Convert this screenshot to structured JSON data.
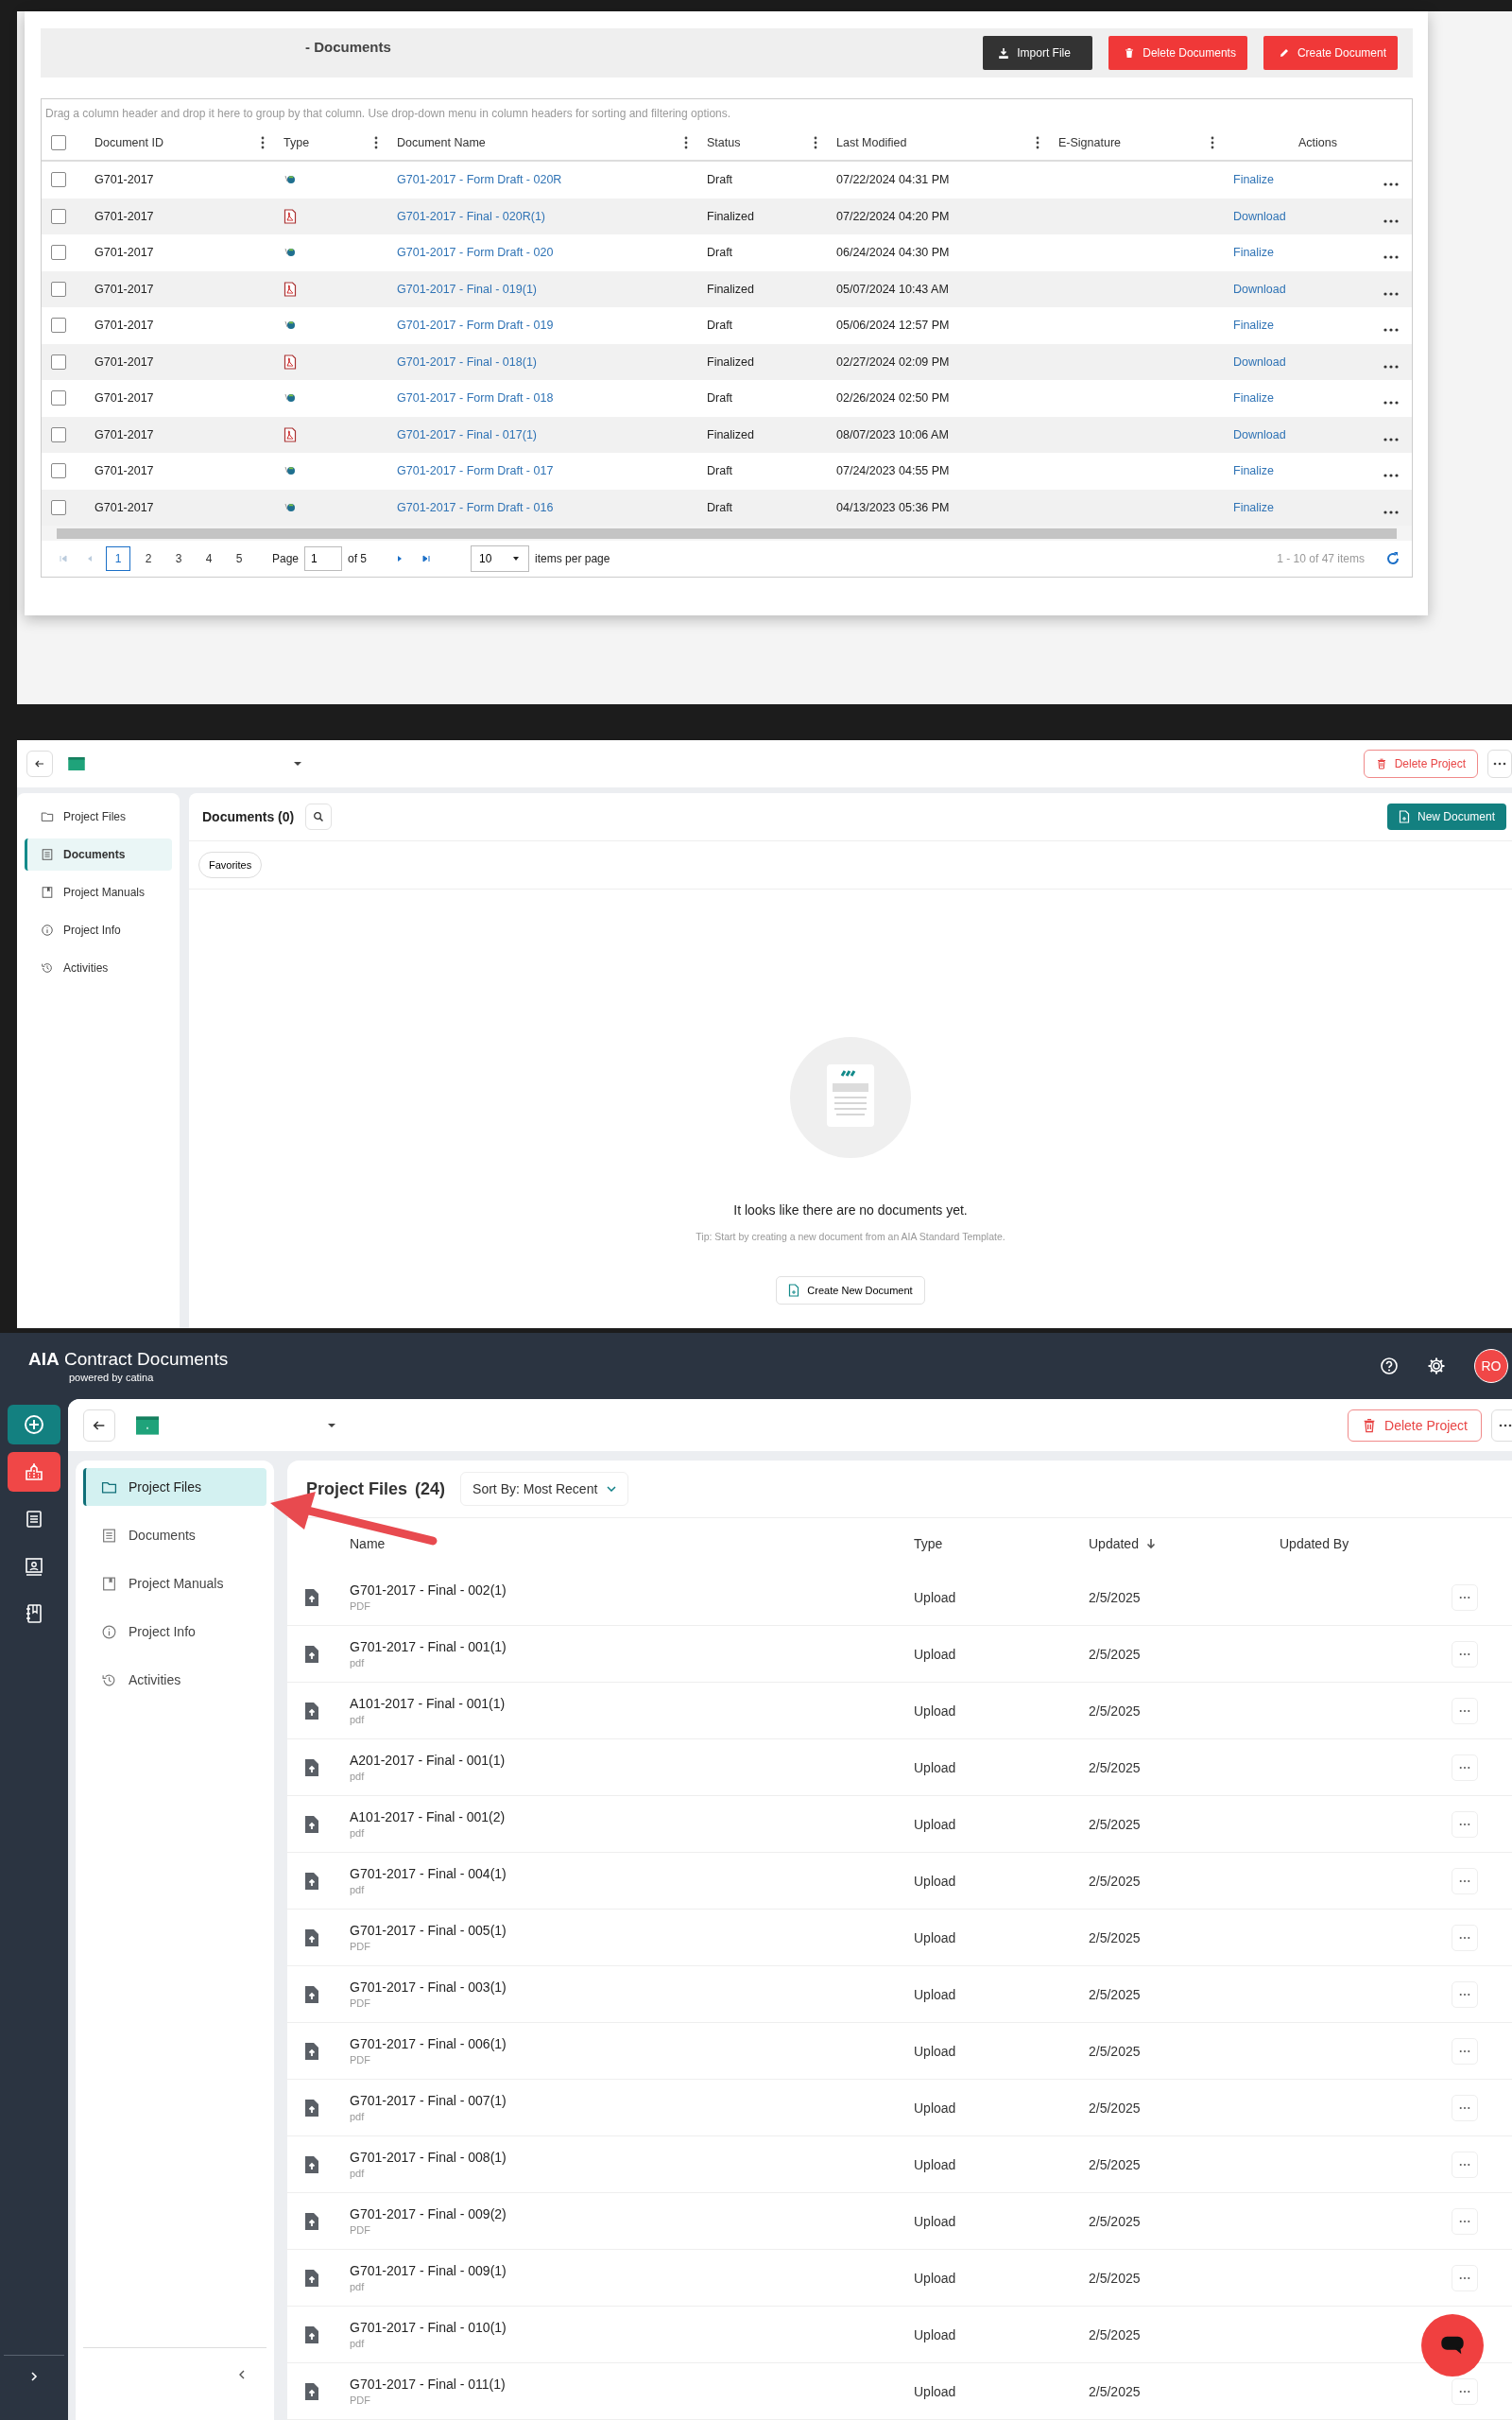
{
  "doc_grid": {
    "title": "- Documents",
    "buttons": [
      {
        "label": "Import File",
        "kind": "import"
      },
      {
        "label": "Delete Documents",
        "kind": "delete"
      },
      {
        "label": "Create Document",
        "kind": "create"
      }
    ],
    "group_hint": "Drag a column header and drop it here to group by that column. Use drop-down menu in column headers for sorting and filtering options.",
    "select_all_checked": false,
    "columns": [
      "Document ID",
      "Type",
      "Document Name",
      "Status",
      "Last Modified",
      "E-Signature",
      "Actions"
    ],
    "rows": [
      {
        "checked": false,
        "id": "G701-2017",
        "kind": "draft",
        "name": "G701-2017 - Form Draft - 020R",
        "status": "Draft",
        "modified": "07/22/2024 04:31 PM",
        "action": "Finalize"
      },
      {
        "checked": false,
        "id": "G701-2017",
        "kind": "pdf",
        "name": "G701-2017 - Final - 020R(1)",
        "status": "Finalized",
        "modified": "07/22/2024 04:20 PM",
        "action": "Download"
      },
      {
        "checked": false,
        "id": "G701-2017",
        "kind": "draft",
        "name": "G701-2017 - Form Draft - 020",
        "status": "Draft",
        "modified": "06/24/2024 04:30 PM",
        "action": "Finalize"
      },
      {
        "checked": false,
        "id": "G701-2017",
        "kind": "pdf",
        "name": "G701-2017 - Final - 019(1)",
        "status": "Finalized",
        "modified": "05/07/2024 10:43 AM",
        "action": "Download"
      },
      {
        "checked": false,
        "id": "G701-2017",
        "kind": "draft",
        "name": "G701-2017 - Form Draft - 019",
        "status": "Draft",
        "modified": "05/06/2024 12:57 PM",
        "action": "Finalize"
      },
      {
        "checked": false,
        "id": "G701-2017",
        "kind": "pdf",
        "name": "G701-2017 - Final - 018(1)",
        "status": "Finalized",
        "modified": "02/27/2024 02:09 PM",
        "action": "Download"
      },
      {
        "checked": false,
        "id": "G701-2017",
        "kind": "draft",
        "name": "G701-2017 - Form Draft - 018",
        "status": "Draft",
        "modified": "02/26/2024 02:50 PM",
        "action": "Finalize"
      },
      {
        "checked": false,
        "id": "G701-2017",
        "kind": "pdf",
        "name": "G701-2017 - Final - 017(1)",
        "status": "Finalized",
        "modified": "08/07/2023 10:06 AM",
        "action": "Download"
      },
      {
        "checked": false,
        "id": "G701-2017",
        "kind": "draft",
        "name": "G701-2017 - Form Draft - 017",
        "status": "Draft",
        "modified": "07/24/2023 04:55 PM",
        "action": "Finalize"
      },
      {
        "checked": false,
        "id": "G701-2017",
        "kind": "draft",
        "name": "G701-2017 - Form Draft - 016",
        "status": "Draft",
        "modified": "04/13/2023 05:36 PM",
        "action": "Finalize"
      }
    ],
    "pager": {
      "pages": [
        {
          "label": "1",
          "selected": true
        },
        {
          "label": "2",
          "selected": false
        },
        {
          "label": "3",
          "selected": false
        },
        {
          "label": "4",
          "selected": false
        },
        {
          "label": "5",
          "selected": false
        }
      ],
      "page_label": "Page",
      "page_value": "1",
      "page_total": "of 5",
      "per_page": "10",
      "per_page_label": "items per page",
      "summary": "1 - 10 of 47 items"
    }
  },
  "project_view": {
    "delete_label": "Delete Project",
    "nav": [
      {
        "label": "Project Files",
        "kind": "folder",
        "selected": false
      },
      {
        "label": "Documents",
        "kind": "document",
        "selected": true
      },
      {
        "label": "Project Manuals",
        "kind": "manual",
        "selected": false
      },
      {
        "label": "Project Info",
        "kind": "info",
        "selected": false
      },
      {
        "label": "Activities",
        "kind": "history",
        "selected": false
      }
    ],
    "title": "Documents (0)",
    "new_button": "New Document",
    "filter": "Favorites",
    "empty_title": "It looks like there are no documents yet.",
    "empty_tip": "Tip: Start by creating a new document from an AIA Standard Template.",
    "create_button": "Create New Document"
  },
  "app": {
    "brand": "**AIA** Contract Documents",
    "powered": "powered by catina",
    "avatar": "RO",
    "rail": [
      {
        "kind": "add",
        "selected": false
      },
      {
        "kind": "building",
        "selected": true
      },
      {
        "kind": "document",
        "selected": false
      },
      {
        "kind": "certificate",
        "selected": false
      },
      {
        "kind": "notebook",
        "selected": false
      }
    ],
    "delete_label": "Delete Project",
    "nav": [
      {
        "label": "Project Files",
        "kind": "folder",
        "selected": true
      },
      {
        "label": "Documents",
        "kind": "document",
        "selected": false
      },
      {
        "label": "Project Manuals",
        "kind": "manual",
        "selected": false
      },
      {
        "label": "Project Info",
        "kind": "info",
        "selected": false
      },
      {
        "label": "Activities",
        "kind": "history",
        "selected": false
      }
    ],
    "title": "Project Files",
    "count": "(24)",
    "sort": "Sort By: Most Recent",
    "columns": [
      "Name",
      "Type",
      "Updated",
      "Updated By"
    ],
    "files": [
      {
        "name": "G701-2017 - Final - 002(1)",
        "ext": "PDF",
        "type": "Upload",
        "updated": "2/5/2025",
        "menu_visible": true
      },
      {
        "name": "G701-2017 - Final - 001(1)",
        "ext": "pdf",
        "type": "Upload",
        "updated": "2/5/2025",
        "menu_visible": true
      },
      {
        "name": "A101-2017 - Final - 001(1)",
        "ext": "pdf",
        "type": "Upload",
        "updated": "2/5/2025",
        "menu_visible": true
      },
      {
        "name": "A201-2017 - Final - 001(1)",
        "ext": "pdf",
        "type": "Upload",
        "updated": "2/5/2025",
        "menu_visible": true
      },
      {
        "name": "A101-2017 - Final - 001(2)",
        "ext": "pdf",
        "type": "Upload",
        "updated": "2/5/2025",
        "menu_visible": true
      },
      {
        "name": "G701-2017 - Final - 004(1)",
        "ext": "pdf",
        "type": "Upload",
        "updated": "2/5/2025",
        "menu_visible": true
      },
      {
        "name": "G701-2017 - Final - 005(1)",
        "ext": "PDF",
        "type": "Upload",
        "updated": "2/5/2025",
        "menu_visible": true
      },
      {
        "name": "G701-2017 - Final - 003(1)",
        "ext": "PDF",
        "type": "Upload",
        "updated": "2/5/2025",
        "menu_visible": true
      },
      {
        "name": "G701-2017 - Final - 006(1)",
        "ext": "PDF",
        "type": "Upload",
        "updated": "2/5/2025",
        "menu_visible": true
      },
      {
        "name": "G701-2017 - Final - 007(1)",
        "ext": "pdf",
        "type": "Upload",
        "updated": "2/5/2025",
        "menu_visible": true
      },
      {
        "name": "G701-2017 - Final - 008(1)",
        "ext": "pdf",
        "type": "Upload",
        "updated": "2/5/2025",
        "menu_visible": true
      },
      {
        "name": "G701-2017 - Final - 009(2)",
        "ext": "PDF",
        "type": "Upload",
        "updated": "2/5/2025",
        "menu_visible": true
      },
      {
        "name": "G701-2017 - Final - 009(1)",
        "ext": "pdf",
        "type": "Upload",
        "updated": "2/5/2025",
        "menu_visible": true
      },
      {
        "name": "G701-2017 - Final - 010(1)",
        "ext": "pdf",
        "type": "Upload",
        "updated": "2/5/2025",
        "menu_visible": false
      },
      {
        "name": "G701-2017 - Final - 011(1)",
        "ext": "PDF",
        "type": "Upload",
        "updated": "2/5/2025",
        "menu_visible": true
      }
    ]
  }
}
